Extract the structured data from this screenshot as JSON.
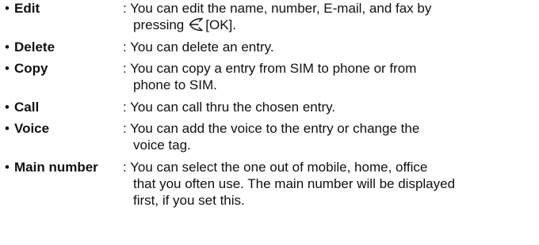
{
  "bullet": "•",
  "entries": [
    {
      "term": "Edit",
      "desc_lines": [
        "You can edit the name, number, E-mail, and fax by"
      ],
      "desc_prefix": "pressing",
      "softkey_label": "[OK].",
      "softkey_icon": "left-softkey-icon"
    },
    {
      "term": "Delete",
      "desc_lines": [
        "You can delete an entry."
      ]
    },
    {
      "term": "Copy",
      "desc_lines": [
        "You can copy a entry from SIM to phone or from",
        "phone to SIM."
      ]
    },
    {
      "term": "Call",
      "desc_lines": [
        "You can call thru the chosen entry."
      ]
    },
    {
      "term": "Voice",
      "desc_lines": [
        "You can add the voice to the entry or change the",
        "voice tag."
      ]
    },
    {
      "term": "Main number",
      "desc_lines": [
        "You can select the one out of mobile, home, office",
        "that you often use. The main number will be displayed",
        "first, if you set this."
      ]
    }
  ]
}
